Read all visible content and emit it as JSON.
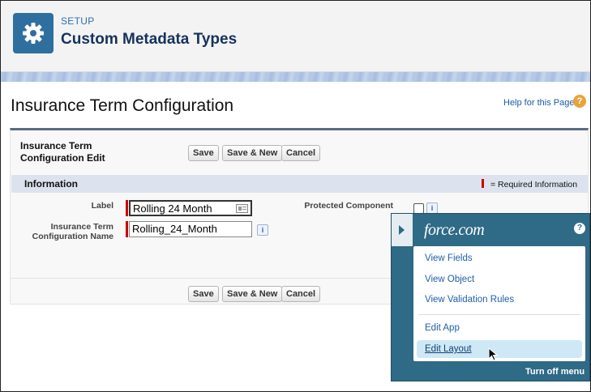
{
  "header": {
    "eyebrow": "SETUP",
    "title": "Custom Metadata Types",
    "icon": "gear-icon"
  },
  "page": {
    "title": "Insurance Term Configuration",
    "help_link": "Help for this Page",
    "help_icon": "?"
  },
  "edit_panel": {
    "title": "Insurance Term Configuration Edit",
    "buttons": {
      "save": "Save",
      "save_new": "Save & New",
      "cancel": "Cancel"
    },
    "section_title": "Information",
    "required_legend": "= Required Information",
    "fields": {
      "label": {
        "label": "Label",
        "value": "Rolling 24 Month"
      },
      "name": {
        "label": "Insurance Term Configuration Name",
        "value": "Rolling_24_Month"
      },
      "protected": {
        "label": "Protected Component",
        "checked": false
      }
    },
    "info_icon": "i"
  },
  "force_menu": {
    "logo": "force.com",
    "help_icon": "?",
    "items": [
      "View Fields",
      "View Object",
      "View Validation Rules",
      "Edit App",
      "Edit Layout"
    ],
    "hovered_item": "Edit Layout",
    "turn_off": "Turn off menu"
  },
  "colors": {
    "brand_blue": "#2f6f9f",
    "menu_teal": "#2f6a86",
    "required_red": "#cc0000",
    "link_blue": "#1a5aa8"
  }
}
